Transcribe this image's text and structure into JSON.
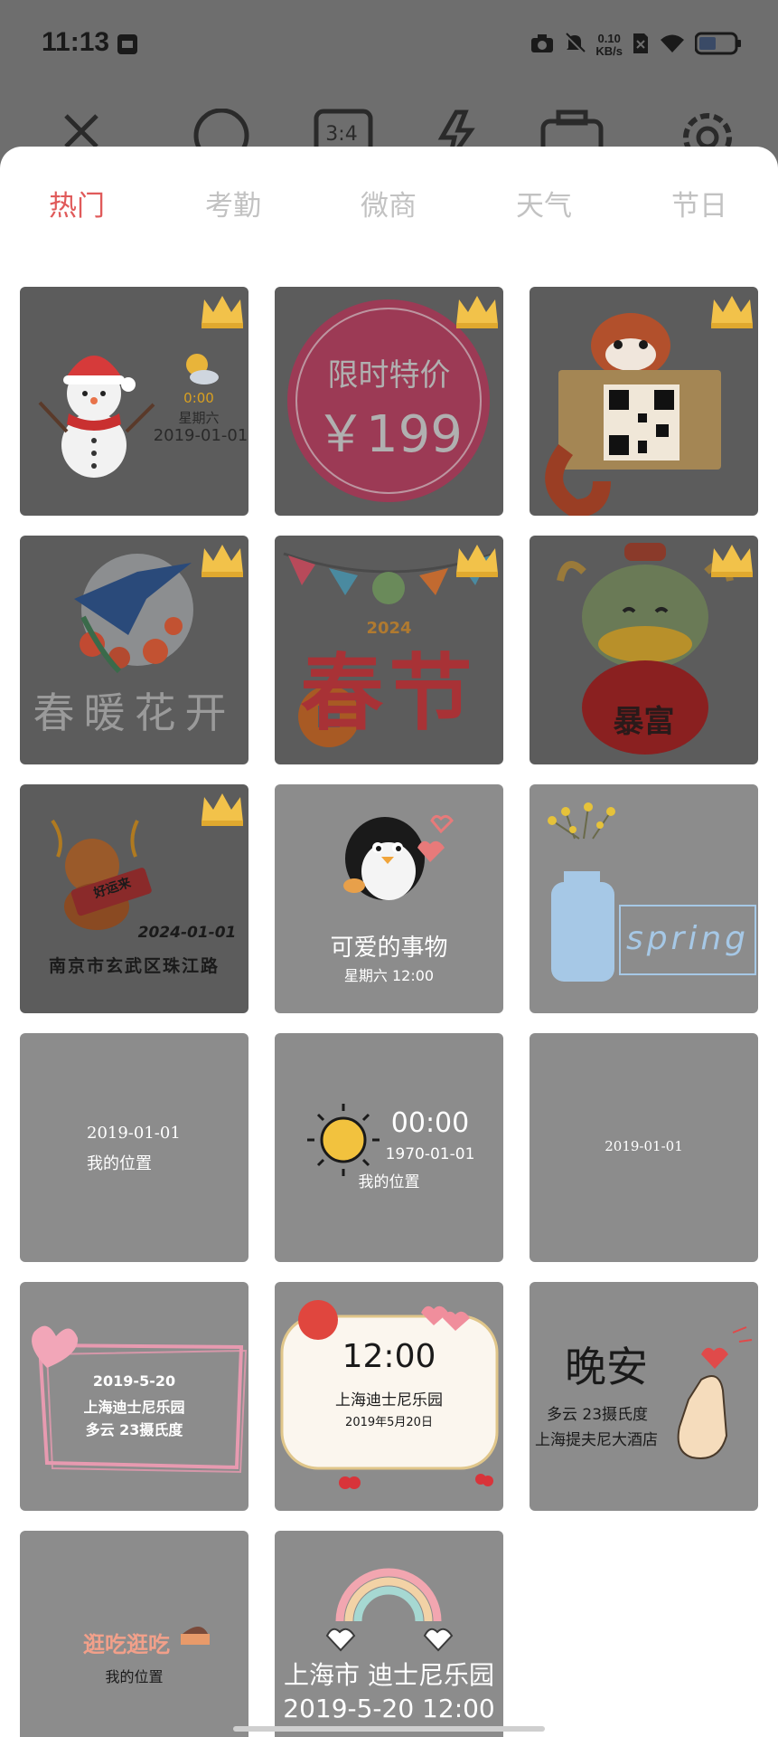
{
  "status_bar": {
    "time": "11:13",
    "net_speed_value": "0.10",
    "net_speed_unit": "KB/s",
    "icons": [
      "sim-card-icon",
      "camera-icon",
      "mute-icon",
      "no-sim-icon",
      "wifi-icon",
      "battery-icon"
    ]
  },
  "camera_toolbar": {
    "icons": [
      "close-icon",
      "portrait-icon",
      "aspect-ratio-icon",
      "flash-off-icon",
      "switch-camera-icon",
      "settings-icon"
    ],
    "aspect_label": "3:4"
  },
  "tabs": [
    "热门",
    "考勤",
    "微商",
    "天气",
    "节日"
  ],
  "active_tab": 0,
  "colors": {
    "active_tab": "#e05a5a",
    "inactive_tab": "#c2c2c2",
    "overlay": "#6e6e6e",
    "card": "#8c8c8c"
  },
  "cards": {
    "c1": {
      "premium": true,
      "time": "0:00",
      "weekday": "星期六",
      "date": "2019-01-01"
    },
    "c2": {
      "premium": true,
      "line1": "限时特价",
      "line2": "￥199"
    },
    "c3": {
      "premium": true
    },
    "c4": {
      "premium": true,
      "text": "春暖花开"
    },
    "c5": {
      "premium": true,
      "year": "2024",
      "text": "春节"
    },
    "c6": {
      "premium": true,
      "bag_text": "暴富"
    },
    "c7": {
      "premium": true,
      "date": "2024-01-01",
      "address": "南京市玄武区珠江路",
      "sign": "好运来"
    },
    "c8": {
      "premium": false,
      "title": "可爱的事物",
      "sub": "星期六 12:00"
    },
    "c9": {
      "premium": false,
      "text": "spring"
    },
    "c10": {
      "premium": false,
      "date": "2019-01-01",
      "location": "我的位置"
    },
    "c11": {
      "premium": false,
      "time": "00:00",
      "date": "1970-01-01",
      "location": "我的位置"
    },
    "c12": {
      "premium": false,
      "date": "2019-01-01"
    },
    "c13": {
      "premium": false,
      "date": "2019-5-20",
      "place": "上海迪士尼乐园",
      "weather": "多云  23摄氏度"
    },
    "c14": {
      "premium": false,
      "time": "12:00",
      "place": "上海迪士尼乐园",
      "date": "2019年5月20日"
    },
    "c15": {
      "premium": false,
      "title": "晚安",
      "weather": "多云  23摄氏度",
      "place": "上海提夫尼大酒店"
    },
    "c16": {
      "premium": false,
      "title": "逛吃逛吃",
      "location": "我的位置"
    },
    "c17": {
      "premium": false,
      "place": "上海市  迪士尼乐园",
      "datetime": "2019-5-20   12:00"
    }
  }
}
